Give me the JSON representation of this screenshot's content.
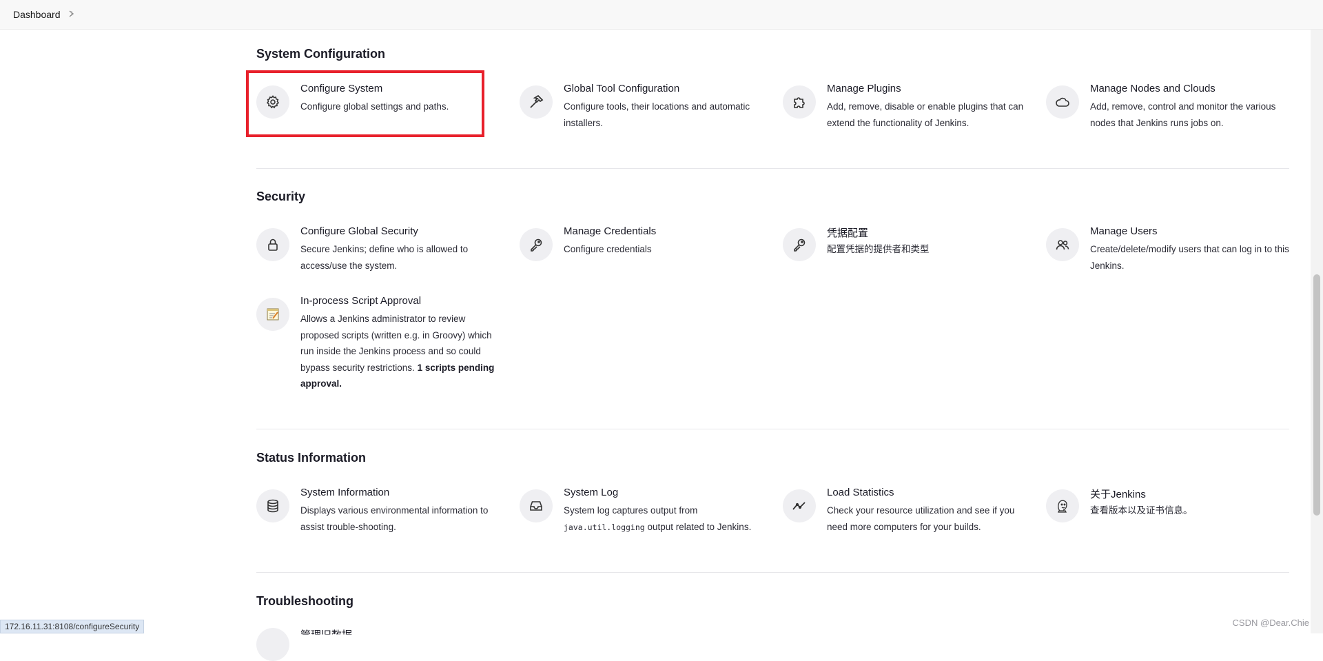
{
  "breadcrumb": {
    "root": "Dashboard"
  },
  "sections": {
    "system_configuration": {
      "title": "System Configuration",
      "items": [
        {
          "title": "Configure System",
          "desc": "Configure global settings and paths.",
          "icon": "gear-icon"
        },
        {
          "title": "Global Tool Configuration",
          "desc": "Configure tools, their locations and automatic installers.",
          "icon": "hammer-icon"
        },
        {
          "title": "Manage Plugins",
          "desc": "Add, remove, disable or enable plugins that can extend the functionality of Jenkins.",
          "icon": "puzzle-icon"
        },
        {
          "title": "Manage Nodes and Clouds",
          "desc": "Add, remove, control and monitor the various nodes that Jenkins runs jobs on.",
          "icon": "cloud-icon"
        }
      ]
    },
    "security": {
      "title": "Security",
      "items": [
        {
          "title": "Configure Global Security",
          "desc": "Secure Jenkins; define who is allowed to access/use the system.",
          "icon": "lock-icon"
        },
        {
          "title": "Manage Credentials",
          "desc": "Configure credentials",
          "icon": "key-icon"
        },
        {
          "title": "凭据配置",
          "desc": "配置凭据的提供者和类型",
          "icon": "key-icon"
        },
        {
          "title": "Manage Users",
          "desc": "Create/delete/modify users that can log in to this Jenkins.",
          "icon": "users-icon"
        },
        {
          "title": "In-process Script Approval",
          "desc": "Allows a Jenkins administrator to review proposed scripts (written e.g. in Groovy) which run inside the Jenkins process and so could bypass security restrictions.",
          "desc_bold": "1 scripts pending approval.",
          "icon": "notepad-icon"
        }
      ]
    },
    "status_information": {
      "title": "Status Information",
      "items": [
        {
          "title": "System Information",
          "desc": "Displays various environmental information to assist trouble-shooting.",
          "icon": "database-icon"
        },
        {
          "title": "System Log",
          "desc_pre": "System log captures output from",
          "desc_code": "java.util.logging",
          "desc_post": "output related to Jenkins.",
          "icon": "inbox-icon"
        },
        {
          "title": "Load Statistics",
          "desc": "Check your resource utilization and see if you need more computers for your builds.",
          "icon": "trend-icon"
        },
        {
          "title": "关于Jenkins",
          "desc": "查看版本以及证书信息。",
          "icon": "jenkins-logo-icon"
        }
      ]
    },
    "troubleshooting": {
      "title": "Troubleshooting",
      "partial_item": "管理旧数据"
    }
  },
  "statusbar": {
    "url": "172.16.11.31:8108/configureSecurity"
  },
  "watermark": "CSDN @Dear.Chie",
  "colors": {
    "highlight": "#e8202b",
    "icon_bg": "#efeff2",
    "divider": "#e6e6ea"
  }
}
